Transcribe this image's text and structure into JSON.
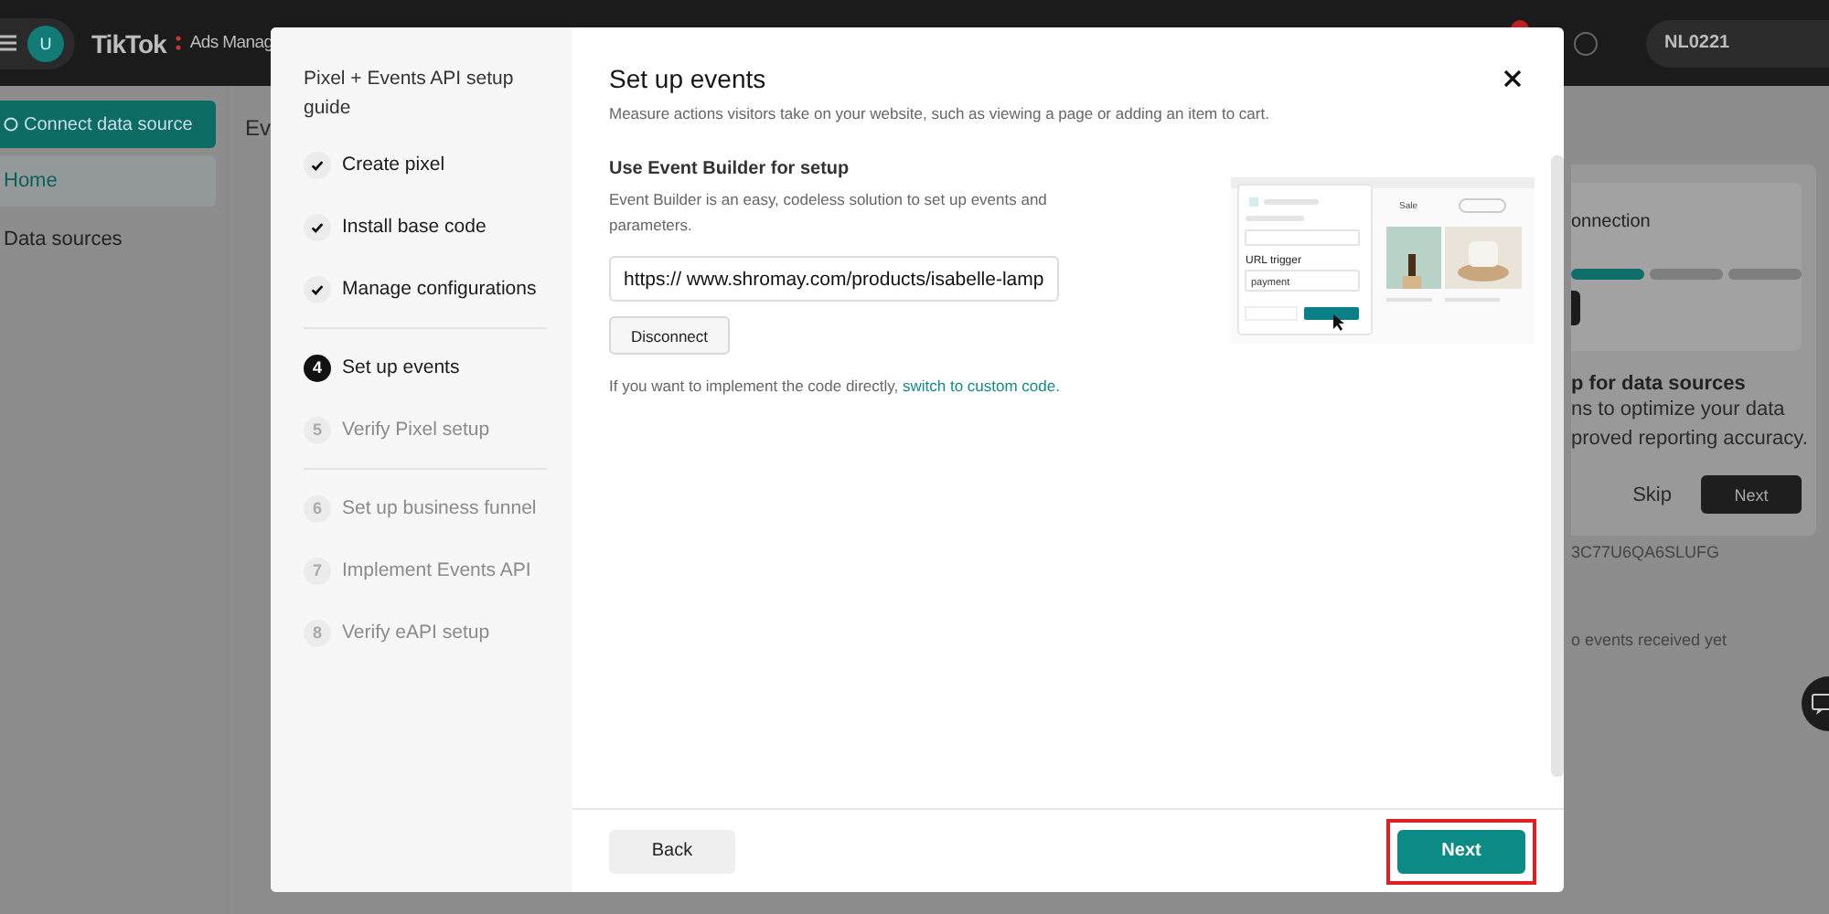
{
  "top_bar": {
    "avatar": "U",
    "logo": "TikTok",
    "product": "Ads Manag",
    "account": "NL0221",
    "notification": true
  },
  "sidebar": {
    "connect_button": "Connect data source",
    "items": [
      {
        "label": "Home",
        "selected": true
      },
      {
        "label": "Data sources",
        "selected": false
      }
    ]
  },
  "main": {
    "title": "Ev"
  },
  "background_card": {
    "title": "onnection",
    "progress_segments": [
      {
        "done": true
      },
      {
        "done": false
      },
      {
        "done": false
      }
    ],
    "heading": "p for data sources",
    "body_lines": [
      "ns to optimize your data",
      "proved reporting accuracy."
    ],
    "skip": "Skip",
    "next": "Next"
  },
  "pixel_id": "3C77U6QA6SLUFG",
  "events_status": "o events received yet",
  "modal": {
    "guide_title": "Pixel + Events API setup guide",
    "step_groups": [
      [
        {
          "label": "Create pixel",
          "done": true,
          "selected": false
        },
        {
          "label": "Install base code",
          "done": true,
          "selected": false
        },
        {
          "label": "Manage configurations",
          "done": true,
          "selected": false
        }
      ],
      [
        {
          "number": "4",
          "label": "Set up events",
          "done": false,
          "selected": true
        },
        {
          "number": "5",
          "label": "Verify Pixel setup",
          "done": false,
          "selected": false
        }
      ],
      [
        {
          "number": "6",
          "label": "Set up business funnel",
          "done": false,
          "selected": false
        },
        {
          "number": "7",
          "label": "Implement Events API",
          "done": false,
          "selected": false
        },
        {
          "number": "8",
          "label": "Verify eAPI setup",
          "done": false,
          "selected": false
        }
      ]
    ],
    "title": "Set up events",
    "description": "Measure actions visitors take on your website, such as viewing a page or adding an item to cart.",
    "section_title": "Use Event Builder for setup",
    "section_description": "Event Builder is an easy, codeless solution to set up events and parameters.",
    "url_value": "https:// www.shromay.com/products/isabelle-lamp",
    "disconnect": "Disconnect",
    "hint": "If you want to implement the code directly, ",
    "link": "switch to custom code.",
    "illustration": {
      "sale": "Sale",
      "trigger_label": "URL trigger",
      "trigger_value": "payment"
    },
    "back": "Back",
    "next": "Next",
    "next_highlighted": true
  }
}
